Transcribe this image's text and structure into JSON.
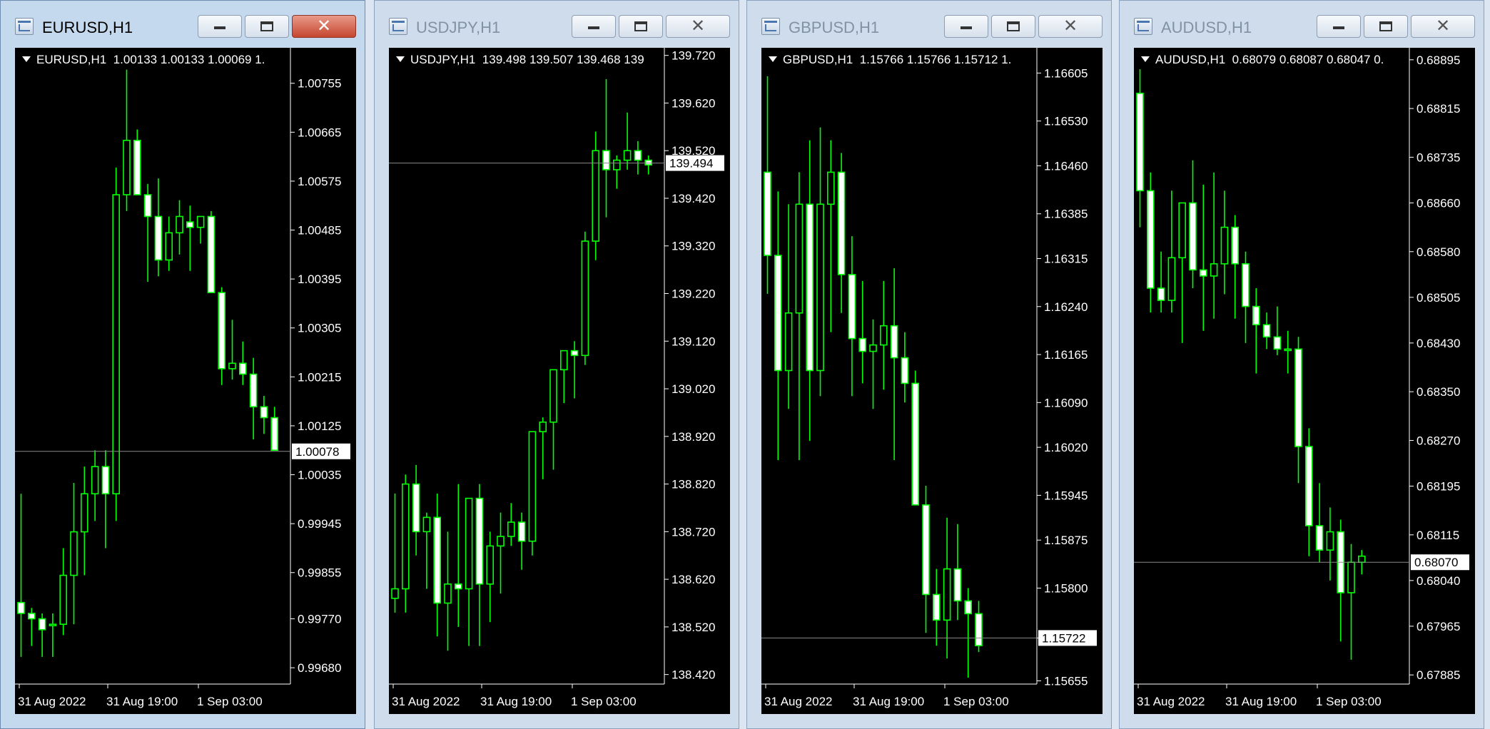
{
  "colors": {
    "bull": "#00ff00",
    "bear_body": "#ffffff",
    "grid": "#ffffff",
    "bid_line": "#8a8a8a",
    "background": "#000000"
  },
  "windows": [
    {
      "title": "EURUSD,H1",
      "active": true,
      "header": "EURUSD,H1  1.00133 1.00133 1.00069 1.",
      "price_label": "1.00078",
      "y_ticks": [
        "1.00755",
        "1.00665",
        "1.00575",
        "1.00485",
        "1.00395",
        "1.00305",
        "1.00215",
        "1.00125",
        "1.00035",
        "0.99945",
        "0.99855",
        "0.99770",
        "0.99680"
      ],
      "x_ticks": [
        "31 Aug 2022",
        "31 Aug 19:00",
        "1 Sep 03:00"
      ],
      "chart_data": {
        "type": "candlestick",
        "ylim": [
          0.9965,
          1.00815
        ],
        "current_price": 1.00078,
        "candles": [
          [
            0.998,
            1.0,
            0.997,
            0.9978
          ],
          [
            0.9978,
            0.9979,
            0.9972,
            0.9977
          ],
          [
            0.9977,
            0.9978,
            0.997,
            0.9975
          ],
          [
            0.9976,
            0.9978,
            0.997,
            0.9976
          ],
          [
            0.9976,
            0.999,
            0.9974,
            0.9985
          ],
          [
            0.9985,
            1.0002,
            0.9976,
            0.9993
          ],
          [
            0.9993,
            1.0005,
            0.9985,
            1.0
          ],
          [
            1.0,
            1.0008,
            0.9995,
            1.0005
          ],
          [
            1.0005,
            1.0008,
            0.999,
            1.0
          ],
          [
            1.0,
            1.006,
            0.9995,
            1.0055
          ],
          [
            1.0055,
            1.0078,
            1.0052,
            1.0065
          ],
          [
            1.0065,
            1.0067,
            1.0055,
            1.0055
          ],
          [
            1.0055,
            1.0057,
            1.0039,
            1.0051
          ],
          [
            1.0051,
            1.0058,
            1.004,
            1.0043
          ],
          [
            1.0043,
            1.0051,
            1.0041,
            1.0048
          ],
          [
            1.0048,
            1.0054,
            1.0044,
            1.0051
          ],
          [
            1.005,
            1.0053,
            1.0041,
            1.0049
          ],
          [
            1.0049,
            1.0051,
            1.0046,
            1.0051
          ],
          [
            1.0051,
            1.0052,
            1.0038,
            1.0037
          ],
          [
            1.0037,
            1.0038,
            1.002,
            1.0023
          ],
          [
            1.0023,
            1.0032,
            1.0021,
            1.0024
          ],
          [
            1.0024,
            1.0028,
            1.002,
            1.0022
          ],
          [
            1.0022,
            1.0025,
            1.001,
            1.0016
          ],
          [
            1.0016,
            1.0018,
            1.0011,
            1.0014
          ],
          [
            1.0014,
            1.0016,
            1.0008,
            1.0008
          ]
        ]
      }
    },
    {
      "title": "USDJPY,H1",
      "active": false,
      "header": "USDJPY,H1  139.498 139.507 139.468 139",
      "price_label": "139.494",
      "y_ticks": [
        "139.720",
        "139.620",
        "139.520",
        "139.420",
        "139.320",
        "139.220",
        "139.120",
        "139.020",
        "138.920",
        "138.820",
        "138.720",
        "138.620",
        "138.520",
        "138.420"
      ],
      "x_ticks": [
        "31 Aug 2022",
        "31 Aug 19:00",
        "1 Sep 03:00"
      ],
      "chart_data": {
        "type": "candlestick",
        "ylim": [
          138.4,
          139.73
        ],
        "current_price": 139.494,
        "candles": [
          [
            138.58,
            138.8,
            138.55,
            138.6
          ],
          [
            138.6,
            138.84,
            138.55,
            138.82
          ],
          [
            138.82,
            138.86,
            138.67,
            138.72
          ],
          [
            138.72,
            138.76,
            138.6,
            138.75
          ],
          [
            138.75,
            138.8,
            138.5,
            138.57
          ],
          [
            138.57,
            138.72,
            138.47,
            138.61
          ],
          [
            138.61,
            138.82,
            138.52,
            138.6
          ],
          [
            138.6,
            138.75,
            138.48,
            138.79
          ],
          [
            138.79,
            138.82,
            138.48,
            138.61
          ],
          [
            138.61,
            138.72,
            138.53,
            138.69
          ],
          [
            138.69,
            138.76,
            138.59,
            138.71
          ],
          [
            138.71,
            138.78,
            138.69,
            138.74
          ],
          [
            138.74,
            138.76,
            138.64,
            138.7
          ],
          [
            138.7,
            138.91,
            138.67,
            138.93
          ],
          [
            138.93,
            138.96,
            138.83,
            138.95
          ],
          [
            138.95,
            139.06,
            138.85,
            139.06
          ],
          [
            139.06,
            139.09,
            138.99,
            139.1
          ],
          [
            139.1,
            139.12,
            139.0,
            139.09
          ],
          [
            139.09,
            139.35,
            139.07,
            139.33
          ],
          [
            139.33,
            139.56,
            139.29,
            139.52
          ],
          [
            139.52,
            139.67,
            139.38,
            139.48
          ],
          [
            139.48,
            139.51,
            139.44,
            139.5
          ],
          [
            139.5,
            139.6,
            139.48,
            139.52
          ],
          [
            139.52,
            139.54,
            139.47,
            139.5
          ],
          [
            139.5,
            139.51,
            139.47,
            139.49
          ]
        ]
      }
    },
    {
      "title": "GBPUSD,H1",
      "active": false,
      "header": "GBPUSD,H1  1.15766 1.15766 1.15712 1.",
      "price_label": "1.15722",
      "y_ticks": [
        "1.16605",
        "1.16530",
        "1.16460",
        "1.16385",
        "1.16315",
        "1.16240",
        "1.16165",
        "1.16090",
        "1.16020",
        "1.15945",
        "1.15875",
        "1.15800",
        "1.15722",
        "1.15655"
      ],
      "x_ticks": [
        "31 Aug 2022",
        "31 Aug 19:00",
        "1 Sep 03:00"
      ],
      "chart_data": {
        "type": "candlestick",
        "ylim": [
          1.1565,
          1.1664
        ],
        "current_price": 1.15722,
        "candles": [
          [
            1.1645,
            1.166,
            1.1626,
            1.1632
          ],
          [
            1.1632,
            1.1642,
            1.16,
            1.1614
          ],
          [
            1.1614,
            1.164,
            1.1608,
            1.1623
          ],
          [
            1.1623,
            1.1645,
            1.16,
            1.164
          ],
          [
            1.164,
            1.165,
            1.1603,
            1.1614
          ],
          [
            1.1614,
            1.1652,
            1.161,
            1.164
          ],
          [
            1.164,
            1.165,
            1.162,
            1.1645
          ],
          [
            1.1645,
            1.1648,
            1.1623,
            1.1629
          ],
          [
            1.1629,
            1.1635,
            1.161,
            1.1619
          ],
          [
            1.1619,
            1.1628,
            1.1612,
            1.1617
          ],
          [
            1.1617,
            1.1622,
            1.1608,
            1.1618
          ],
          [
            1.1618,
            1.1628,
            1.1611,
            1.1621
          ],
          [
            1.1621,
            1.163,
            1.16,
            1.1616
          ],
          [
            1.1616,
            1.162,
            1.1609,
            1.1612
          ],
          [
            1.1612,
            1.1614,
            1.1596,
            1.1593
          ],
          [
            1.1593,
            1.1596,
            1.1573,
            1.1579
          ],
          [
            1.1579,
            1.1583,
            1.1571,
            1.1575
          ],
          [
            1.1575,
            1.1591,
            1.1569,
            1.1583
          ],
          [
            1.1583,
            1.159,
            1.1575,
            1.1578
          ],
          [
            1.1578,
            1.158,
            1.1566,
            1.1576
          ],
          [
            1.1576,
            1.1578,
            1.157,
            1.1571
          ]
        ]
      }
    },
    {
      "title": "AUDUSD,H1",
      "active": false,
      "header": "AUDUSD,H1  0.68079 0.68087 0.68047 0.",
      "price_label": "0.68070",
      "y_ticks": [
        "0.68895",
        "0.68815",
        "0.68735",
        "0.68660",
        "0.68580",
        "0.68505",
        "0.68430",
        "0.68350",
        "0.68270",
        "0.68195",
        "0.68115",
        "0.68040",
        "0.67965",
        "0.67885"
      ],
      "x_ticks": [
        "31 Aug 2022",
        "31 Aug 19:00",
        "1 Sep 03:00"
      ],
      "chart_data": {
        "type": "candlestick",
        "ylim": [
          0.6787,
          0.6891
        ],
        "current_price": 0.6807,
        "candles": [
          [
            0.6884,
            0.6888,
            0.6862,
            0.6868
          ],
          [
            0.6868,
            0.6871,
            0.6848,
            0.6852
          ],
          [
            0.6852,
            0.6858,
            0.6848,
            0.685
          ],
          [
            0.685,
            0.6868,
            0.6848,
            0.6857
          ],
          [
            0.6857,
            0.6866,
            0.6843,
            0.6866
          ],
          [
            0.6866,
            0.6873,
            0.6852,
            0.6855
          ],
          [
            0.6855,
            0.6869,
            0.6845,
            0.6854
          ],
          [
            0.6854,
            0.6871,
            0.6847,
            0.6856
          ],
          [
            0.6856,
            0.6868,
            0.6851,
            0.6862
          ],
          [
            0.6862,
            0.6864,
            0.6847,
            0.6856
          ],
          [
            0.6856,
            0.6858,
            0.6843,
            0.6849
          ],
          [
            0.6849,
            0.6852,
            0.6838,
            0.6846
          ],
          [
            0.6846,
            0.6848,
            0.6842,
            0.6844
          ],
          [
            0.6844,
            0.6849,
            0.6841,
            0.6842
          ],
          [
            0.6842,
            0.6845,
            0.6838,
            0.6842
          ],
          [
            0.6842,
            0.6844,
            0.682,
            0.6826
          ],
          [
            0.6826,
            0.6829,
            0.6808,
            0.6813
          ],
          [
            0.6813,
            0.682,
            0.6807,
            0.6809
          ],
          [
            0.6809,
            0.6816,
            0.6804,
            0.6812
          ],
          [
            0.6812,
            0.6814,
            0.6794,
            0.6802
          ],
          [
            0.6802,
            0.681,
            0.6791,
            0.6807
          ],
          [
            0.6807,
            0.6809,
            0.6805,
            0.6808
          ]
        ]
      }
    }
  ]
}
